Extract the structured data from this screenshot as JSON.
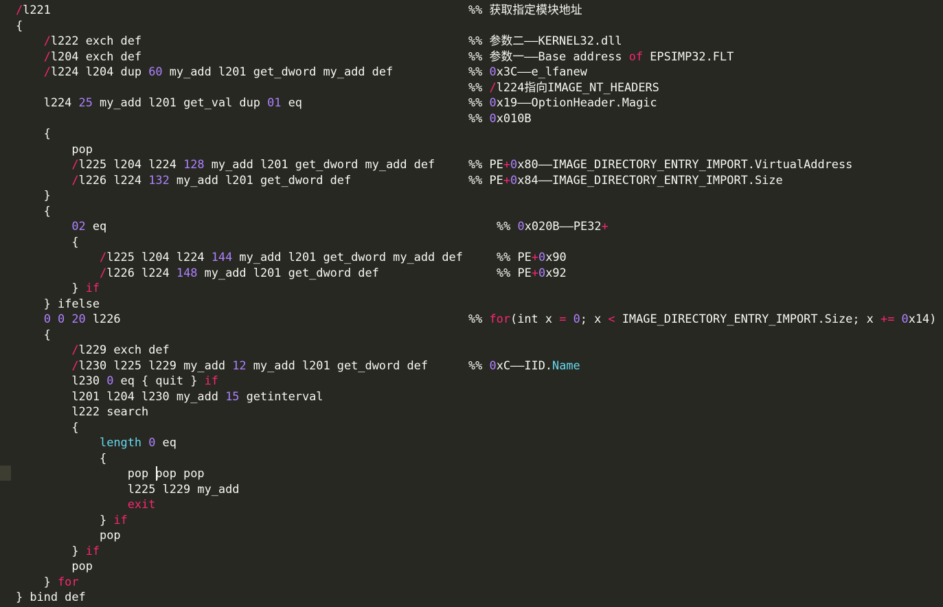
{
  "editor": {
    "colors": {
      "background": "#272822",
      "foreground": "#f8f8f2",
      "keyword": "#f92672",
      "number": "#ae81ff",
      "builtin": "#66d9ef"
    },
    "lines": [
      {
        "code": [
          [
            "slash",
            "/"
          ],
          [
            "plain",
            "l221"
          ]
        ],
        "comment": [
          [
            "plain",
            "%% 获取指定模块地址"
          ]
        ]
      },
      {
        "code": [
          [
            "plain",
            "{"
          ]
        ]
      },
      {
        "code": [
          [
            "plain",
            "    "
          ],
          [
            "slash",
            "/"
          ],
          [
            "plain",
            "l222 exch def"
          ]
        ],
        "comment": [
          [
            "plain",
            "%% 参数二——KERNEL32.dll"
          ]
        ]
      },
      {
        "code": [
          [
            "plain",
            "    "
          ],
          [
            "slash",
            "/"
          ],
          [
            "plain",
            "l204 exch def"
          ]
        ],
        "comment": [
          [
            "plain",
            "%% 参数一——Base address "
          ],
          [
            "kw",
            "of"
          ],
          [
            "plain",
            " EPSIMP32.FLT"
          ]
        ]
      },
      {
        "code": [
          [
            "plain",
            "    "
          ],
          [
            "slash",
            "/"
          ],
          [
            "plain",
            "l224 l204 dup "
          ],
          [
            "num",
            "60"
          ],
          [
            "plain",
            " my_add l201 get_dword my_add def"
          ]
        ],
        "comment": [
          [
            "plain",
            "%% "
          ],
          [
            "num",
            "0"
          ],
          [
            "plain",
            "x3C——e_lfanew"
          ]
        ]
      },
      {
        "code": [],
        "comment": [
          [
            "plain",
            "%% "
          ],
          [
            "slash",
            "/"
          ],
          [
            "plain",
            "l224指向IMAGE_NT_HEADERS"
          ]
        ]
      },
      {
        "code": [
          [
            "plain",
            "    l224 "
          ],
          [
            "num",
            "25"
          ],
          [
            "plain",
            " my_add l201 get_val dup "
          ],
          [
            "num",
            "01"
          ],
          [
            "plain",
            " eq"
          ]
        ],
        "comment": [
          [
            "plain",
            "%% "
          ],
          [
            "num",
            "0"
          ],
          [
            "plain",
            "x19——OptionHeader.Magic"
          ]
        ]
      },
      {
        "code": [],
        "comment": [
          [
            "plain",
            "%% "
          ],
          [
            "num",
            "0"
          ],
          [
            "plain",
            "x010B"
          ]
        ]
      },
      {
        "code": [
          [
            "plain",
            "    {"
          ]
        ]
      },
      {
        "code": [
          [
            "plain",
            "        pop"
          ]
        ]
      },
      {
        "code": [
          [
            "plain",
            "        "
          ],
          [
            "slash",
            "/"
          ],
          [
            "plain",
            "l225 l204 l224 "
          ],
          [
            "num",
            "128"
          ],
          [
            "plain",
            " my_add l201 get_dword my_add def"
          ]
        ],
        "comment": [
          [
            "plain",
            "%% PE"
          ],
          [
            "kw",
            "+"
          ],
          [
            "num",
            "0"
          ],
          [
            "plain",
            "x80——IMAGE_DIRECTORY_ENTRY_IMPORT.VirtualAddress"
          ]
        ]
      },
      {
        "code": [
          [
            "plain",
            "        "
          ],
          [
            "slash",
            "/"
          ],
          [
            "plain",
            "l226 l224 "
          ],
          [
            "num",
            "132"
          ],
          [
            "plain",
            " my_add l201 get_dword def"
          ]
        ],
        "comment": [
          [
            "plain",
            "%% PE"
          ],
          [
            "kw",
            "+"
          ],
          [
            "num",
            "0"
          ],
          [
            "plain",
            "x84——IMAGE_DIRECTORY_ENTRY_IMPORT.Size"
          ]
        ]
      },
      {
        "code": [
          [
            "plain",
            "    }"
          ]
        ]
      },
      {
        "code": [
          [
            "plain",
            "    {"
          ]
        ]
      },
      {
        "code": [
          [
            "plain",
            "        "
          ],
          [
            "num",
            "02"
          ],
          [
            "plain",
            " eq"
          ]
        ],
        "comment": [
          [
            "plain",
            "%% "
          ],
          [
            "num",
            "0"
          ],
          [
            "plain",
            "x020B——PE32"
          ],
          [
            "kw",
            "+"
          ]
        ],
        "commentIndent": true
      },
      {
        "code": [
          [
            "plain",
            "        {"
          ]
        ]
      },
      {
        "code": [
          [
            "plain",
            "            "
          ],
          [
            "slash",
            "/"
          ],
          [
            "plain",
            "l225 l204 l224 "
          ],
          [
            "num",
            "144"
          ],
          [
            "plain",
            " my_add l201 get_dword my_add def"
          ]
        ],
        "comment": [
          [
            "plain",
            "%% PE"
          ],
          [
            "kw",
            "+"
          ],
          [
            "num",
            "0"
          ],
          [
            "plain",
            "x90"
          ]
        ],
        "commentIndent": true
      },
      {
        "code": [
          [
            "plain",
            "            "
          ],
          [
            "slash",
            "/"
          ],
          [
            "plain",
            "l226 l224 "
          ],
          [
            "num",
            "148"
          ],
          [
            "plain",
            " my_add l201 get_dword def"
          ]
        ],
        "comment": [
          [
            "plain",
            "%% PE"
          ],
          [
            "kw",
            "+"
          ],
          [
            "num",
            "0"
          ],
          [
            "plain",
            "x92"
          ]
        ],
        "commentIndent": true
      },
      {
        "code": [
          [
            "plain",
            "        } "
          ],
          [
            "kw",
            "if"
          ]
        ]
      },
      {
        "code": [
          [
            "plain",
            "    } ifelse"
          ]
        ]
      },
      {
        "code": [
          [
            "plain",
            "    "
          ],
          [
            "num",
            "0"
          ],
          [
            "plain",
            " "
          ],
          [
            "num",
            "0"
          ],
          [
            "plain",
            " "
          ],
          [
            "num",
            "20"
          ],
          [
            "plain",
            " l226"
          ]
        ],
        "comment": [
          [
            "plain",
            "%% "
          ],
          [
            "kw",
            "for"
          ],
          [
            "plain",
            "(int x "
          ],
          [
            "kw",
            "="
          ],
          [
            "plain",
            " "
          ],
          [
            "num",
            "0"
          ],
          [
            "plain",
            "; x "
          ],
          [
            "kw",
            "<"
          ],
          [
            "plain",
            " IMAGE_DIRECTORY_ENTRY_IMPORT.Size; x "
          ],
          [
            "kw",
            "+="
          ],
          [
            "plain",
            " "
          ],
          [
            "num",
            "0"
          ],
          [
            "plain",
            "x14)"
          ]
        ]
      },
      {
        "code": [
          [
            "plain",
            "    {"
          ]
        ]
      },
      {
        "code": [
          [
            "plain",
            "        "
          ],
          [
            "slash",
            "/"
          ],
          [
            "plain",
            "l229 exch def"
          ]
        ]
      },
      {
        "code": [
          [
            "plain",
            "        "
          ],
          [
            "slash",
            "/"
          ],
          [
            "plain",
            "l230 l225 l229 my_add "
          ],
          [
            "num",
            "12"
          ],
          [
            "plain",
            " my_add l201 get_dword def"
          ]
        ],
        "comment": [
          [
            "plain",
            "%% "
          ],
          [
            "num",
            "0"
          ],
          [
            "plain",
            "xC——IID."
          ],
          [
            "fn",
            "Name"
          ]
        ]
      },
      {
        "code": [
          [
            "plain",
            "        l230 "
          ],
          [
            "num",
            "0"
          ],
          [
            "plain",
            " eq { quit } "
          ],
          [
            "kw",
            "if"
          ]
        ]
      },
      {
        "code": [
          [
            "plain",
            "        l201 l204 l230 my_add "
          ],
          [
            "num",
            "15"
          ],
          [
            "plain",
            " getinterval"
          ]
        ]
      },
      {
        "code": [
          [
            "plain",
            "        l222 search"
          ]
        ]
      },
      {
        "code": [
          [
            "plain",
            "        {"
          ]
        ]
      },
      {
        "code": [
          [
            "plain",
            "            "
          ],
          [
            "fn",
            "length"
          ],
          [
            "plain",
            " "
          ],
          [
            "num",
            "0"
          ],
          [
            "plain",
            " eq"
          ]
        ]
      },
      {
        "code": [
          [
            "plain",
            "            {"
          ]
        ]
      },
      {
        "code": [
          [
            "plain",
            "                pop pop pop"
          ]
        ]
      },
      {
        "code": [
          [
            "plain",
            "                l225 l229 my_add"
          ]
        ]
      },
      {
        "code": [
          [
            "plain",
            "                "
          ],
          [
            "kw",
            "exit"
          ]
        ]
      },
      {
        "code": [
          [
            "plain",
            "            } "
          ],
          [
            "kw",
            "if"
          ]
        ]
      },
      {
        "code": [
          [
            "plain",
            "            pop"
          ]
        ]
      },
      {
        "code": [
          [
            "plain",
            "        } "
          ],
          [
            "kw",
            "if"
          ]
        ]
      },
      {
        "code": [
          [
            "plain",
            "        pop"
          ]
        ]
      },
      {
        "code": [
          [
            "plain",
            "    } "
          ],
          [
            "kw",
            "for"
          ]
        ]
      },
      {
        "code": [
          [
            "plain",
            "} bind def"
          ]
        ]
      }
    ]
  }
}
